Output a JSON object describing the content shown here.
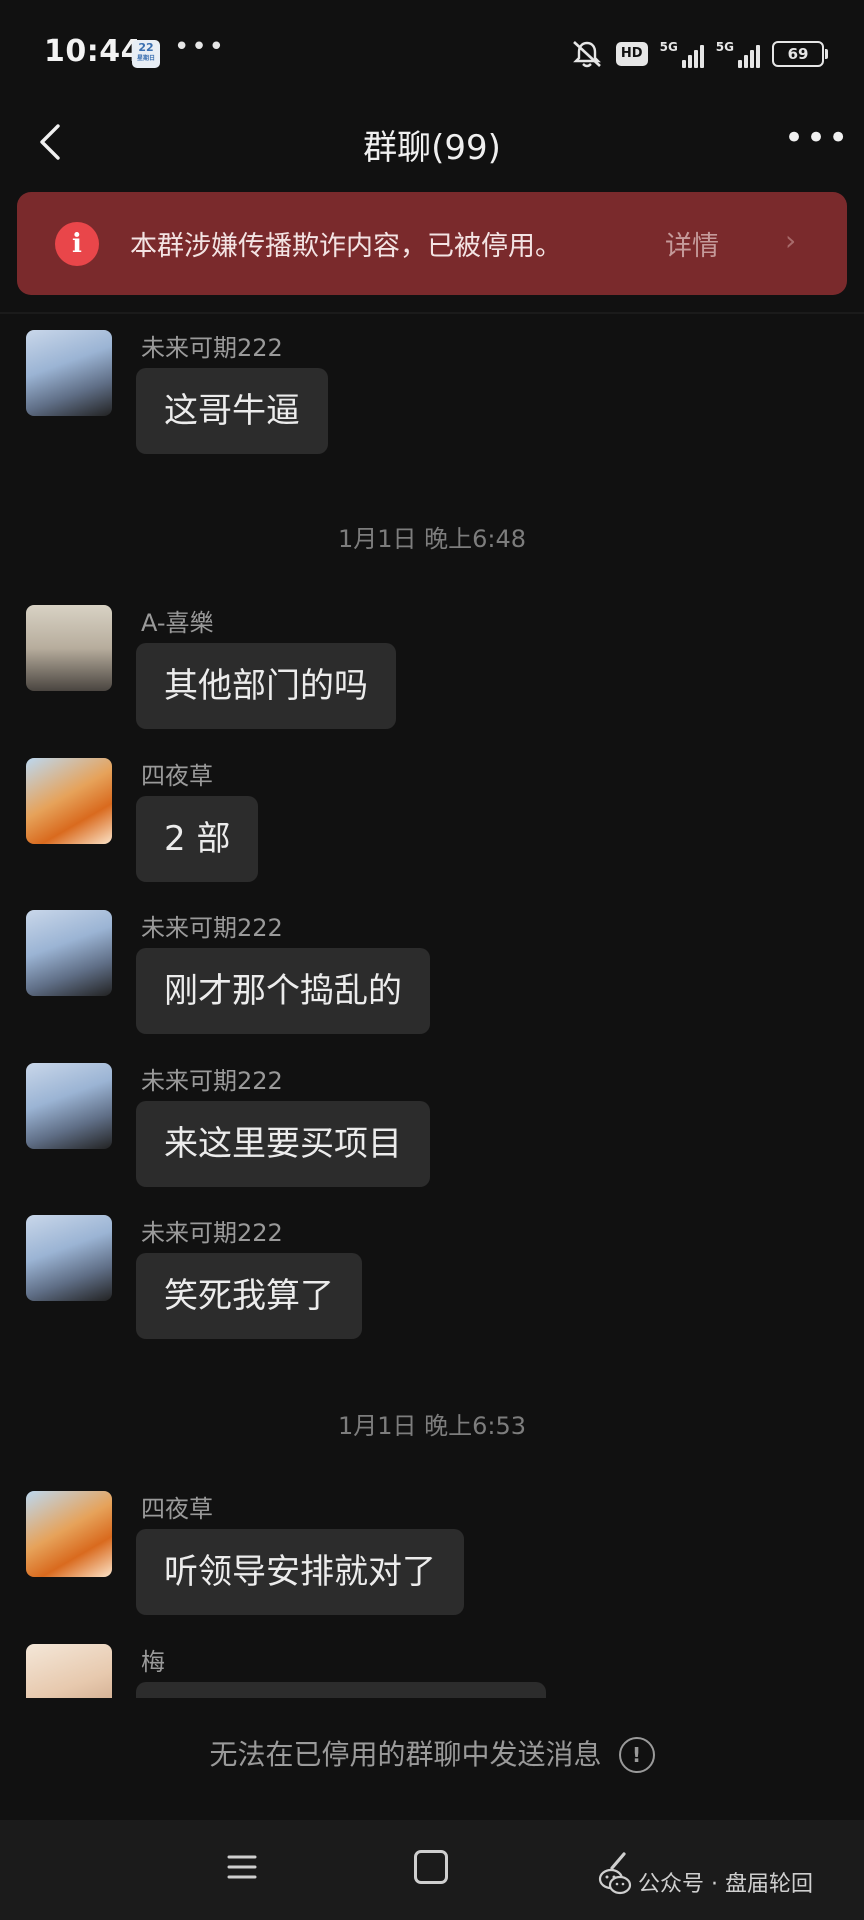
{
  "status_bar": {
    "time": "10:44",
    "calendar_day": "22",
    "calendar_sub": "星期日",
    "overflow": "•••",
    "hd": "HD",
    "net1": "5G",
    "net2": "5G",
    "battery": "69"
  },
  "header": {
    "title": "群聊(99)",
    "more": "•••"
  },
  "alert": {
    "icon": "i",
    "text": "本群涉嫌传播欺诈内容，已被停用。",
    "detail": "详情",
    "chevron": "›"
  },
  "chat": {
    "timestamps": [
      "1月1日 晚上6:48",
      "1月1日 晚上6:53"
    ],
    "messages": [
      {
        "sender": "未来可期222",
        "text": "这哥牛逼"
      },
      {
        "sender": "A-喜樂",
        "text": "其他部门的吗"
      },
      {
        "sender": "四夜草",
        "text": "2 部"
      },
      {
        "sender": "未来可期222",
        "text": "刚才那个捣乱的"
      },
      {
        "sender": "未来可期222",
        "text": "来这里要买项目"
      },
      {
        "sender": "未来可期222",
        "text": "笑死我算了"
      },
      {
        "sender": "四夜草",
        "text": "听领导安排就对了"
      },
      {
        "sender": "梅",
        "text": ""
      }
    ]
  },
  "footer": {
    "disabled_text": "无法在已停用的群聊中发送消息",
    "info_icon": "!"
  },
  "watermark": {
    "text": "公众号 · 盘届轮回"
  },
  "colors": {
    "background": "#111111",
    "bubble": "#2c2c2c",
    "alert_bg": "#7a2a2c",
    "alert_icon": "#e9464a"
  }
}
